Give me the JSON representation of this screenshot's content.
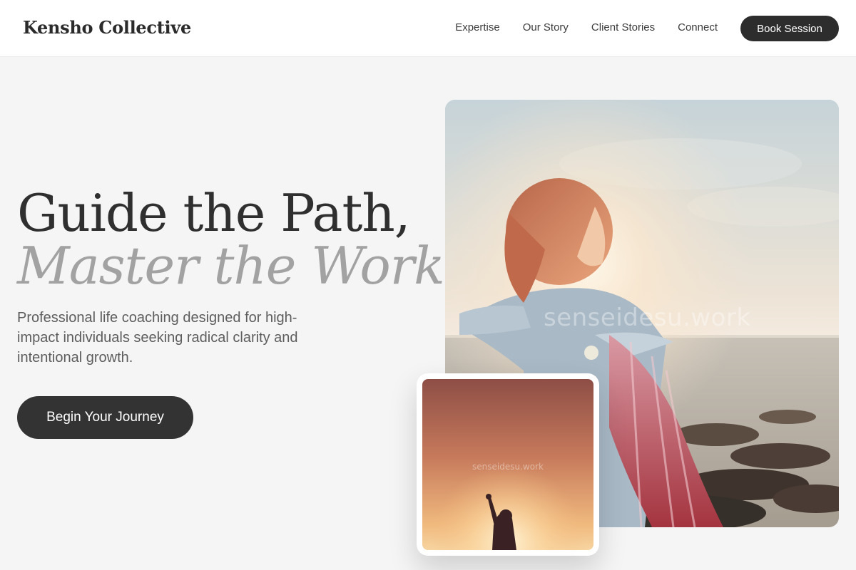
{
  "brand": {
    "name": "Kensho Collective"
  },
  "nav": {
    "items": [
      {
        "label": "Expertise"
      },
      {
        "label": "Our Story"
      },
      {
        "label": "Client Stories"
      },
      {
        "label": "Connect"
      }
    ],
    "cta_label": "Book Session"
  },
  "hero": {
    "title_line1": "Guide the Path,",
    "title_line2": "Master the Work.",
    "subtitle": "Professional life coaching designed for high-impact individuals seeking radical clarity and intentional growth.",
    "cta_label": "Begin Your Journey"
  },
  "images": {
    "main_watermark": "senseidesu.work",
    "card_watermark": "senseidesu.work"
  },
  "colors": {
    "dark_button": "#2d2d2d",
    "page_background": "#f5f5f5",
    "accent_muted": "#a2a2a2"
  }
}
